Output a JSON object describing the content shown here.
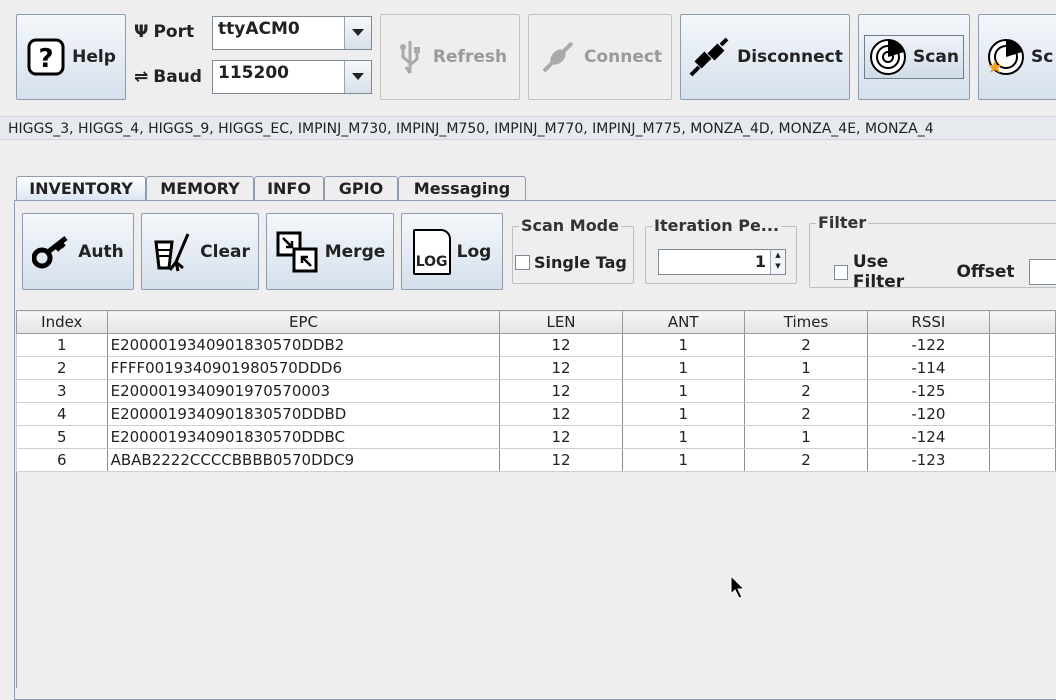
{
  "toolbar": {
    "help_label": "Help",
    "port_label": "Port",
    "port_value": "ttyACM0",
    "baud_label": "Baud",
    "baud_value": "115200",
    "refresh_label": "Refresh",
    "connect_label": "Connect",
    "disconnect_label": "Disconnect",
    "scan_label": "Scan",
    "scan2_label_partial": "Sc"
  },
  "tag_types": "HIGGS_3, HIGGS_4, HIGGS_9, HIGGS_EC, IMPINJ_M730, IMPINJ_M750, IMPINJ_M770, IMPINJ_M775, MONZA_4D, MONZA_4E, MONZA_4",
  "tabs": [
    {
      "label": "INVENTORY",
      "active": true
    },
    {
      "label": "MEMORY",
      "active": false
    },
    {
      "label": "INFO",
      "active": false
    },
    {
      "label": "GPIO",
      "active": false
    },
    {
      "label": "Messaging",
      "active": false
    }
  ],
  "inventory": {
    "auth_label": "Auth",
    "clear_label": "Clear",
    "merge_label": "Merge",
    "log_label": "Log",
    "log_icon_text": "LOG",
    "scan_mode": {
      "title": "Scan Mode",
      "single_tag_label": "Single Tag",
      "single_tag_checked": false
    },
    "iteration": {
      "title": "Iteration Pe...",
      "value": "1"
    },
    "filter": {
      "title": "Filter",
      "use_filter_label": "Use Filter",
      "use_filter_checked": false,
      "offset_label": "Offset"
    }
  },
  "table": {
    "columns": [
      "Index",
      "EPC",
      "LEN",
      "ANT",
      "Times",
      "RSSI",
      ""
    ],
    "rows": [
      [
        "1",
        "E2000019340901830570DDB2",
        "12",
        "1",
        "2",
        "-122"
      ],
      [
        "2",
        "FFFF0019340901980570DDD6",
        "12",
        "1",
        "1",
        "-114"
      ],
      [
        "3",
        "E2000019340901970570003",
        "12",
        "1",
        "2",
        "-125"
      ],
      [
        "4",
        "E2000019340901830570DDBD",
        "12",
        "1",
        "2",
        "-120"
      ],
      [
        "5",
        "E2000019340901830570DDBC",
        "12",
        "1",
        "1",
        "-124"
      ],
      [
        "6",
        "ABAB2222CCCCBBBB0570DDC9",
        "12",
        "1",
        "2",
        "-123"
      ]
    ]
  },
  "colors": {
    "accent": "#d5e0ec",
    "border": "#8e9cad",
    "disabled_text": "#9a9a9a"
  }
}
